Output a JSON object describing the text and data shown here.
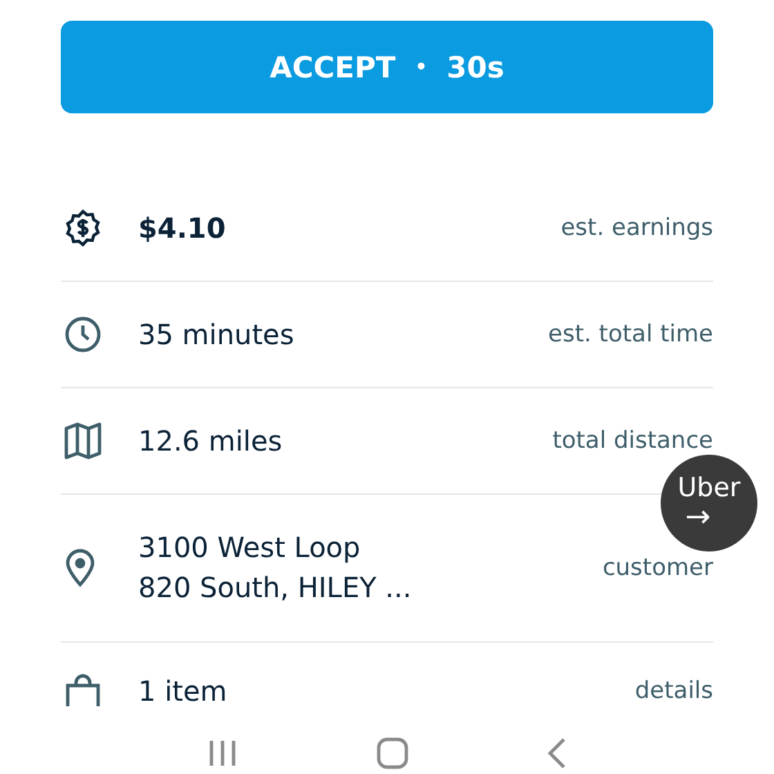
{
  "accept_button": {
    "label": "ACCEPT",
    "separator": "•",
    "countdown": "30s"
  },
  "details": [
    {
      "kind": "money",
      "value": [
        "$4.10"
      ],
      "bold": true,
      "label": "est. earnings"
    },
    {
      "kind": "clock",
      "value": [
        "35 minutes"
      ],
      "bold": false,
      "label": "est. total time"
    },
    {
      "kind": "map",
      "value": [
        "12.6 miles"
      ],
      "bold": false,
      "label": "total distance"
    },
    {
      "kind": "pin",
      "value": [
        "3100 West Loop",
        "820 South, HILEY ..."
      ],
      "bold": false,
      "label": "customer"
    },
    {
      "kind": "bag",
      "value": [
        "1 item"
      ],
      "bold": false,
      "label": "details"
    }
  ],
  "floating_bubble": {
    "label": "Uber",
    "arrow": "→"
  },
  "nav_bar": [
    {
      "kind": "recents"
    },
    {
      "kind": "home"
    },
    {
      "kind": "back"
    }
  ]
}
